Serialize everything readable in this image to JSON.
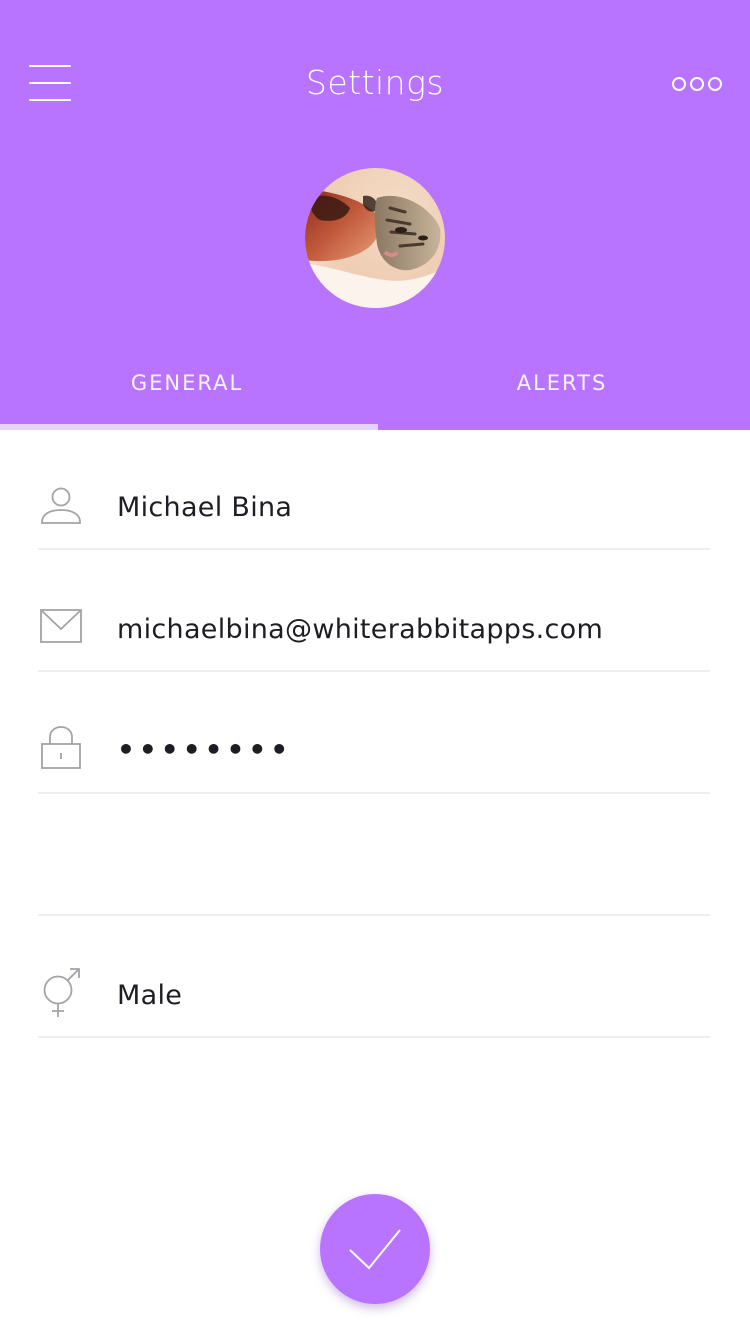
{
  "header": {
    "title": "Settings",
    "background_color": "#b974ff",
    "menu_icon": "hamburger-menu-icon",
    "more_icon": "more-options-icon"
  },
  "profile": {
    "avatar": "profile-photo-man-with-cat"
  },
  "tabs": [
    {
      "label": "GENERAL",
      "active": true
    },
    {
      "label": "ALERTS",
      "active": false
    }
  ],
  "form": {
    "name": {
      "icon": "user-icon",
      "value": "Michael Bina"
    },
    "email": {
      "icon": "mail-icon",
      "value": "michaelbina@whiterabbitapps.com"
    },
    "password": {
      "icon": "lock-icon",
      "value": "••••••••"
    },
    "empty_row": {
      "value": ""
    },
    "gender": {
      "icon": "gender-icon",
      "value": "Male"
    }
  },
  "confirm_button": {
    "icon": "checkmark-icon",
    "color": "#b974ff"
  }
}
